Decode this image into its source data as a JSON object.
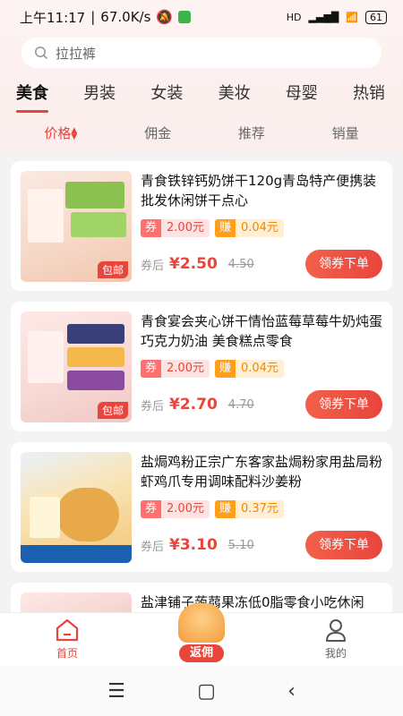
{
  "status_bar": {
    "time": "上午11:17",
    "speed": "67.0K/s",
    "network": "HD",
    "battery": "61"
  },
  "search": {
    "placeholder": "拉拉裤"
  },
  "categories": [
    "美食",
    "男装",
    "女装",
    "美妆",
    "母婴",
    "热销"
  ],
  "sort_options": [
    "价格",
    "佣金",
    "推荐",
    "销量"
  ],
  "products": [
    {
      "title": "青食铁锌钙奶饼干120g青岛特产便携装批发休闲饼干点心",
      "coupon_label": "券",
      "coupon_value": "2.00元",
      "earn_label": "赚",
      "earn_value": "0.04元",
      "after_label": "券后",
      "price": "¥2.50",
      "original_price": "4.50",
      "buy_label": "领券下单",
      "badge": "包邮"
    },
    {
      "title": "青食宴会夹心饼干情怡蓝莓草莓牛奶炖蛋巧克力奶油 美食糕点零食",
      "coupon_label": "券",
      "coupon_value": "2.00元",
      "earn_label": "赚",
      "earn_value": "0.04元",
      "after_label": "券后",
      "price": "¥2.70",
      "original_price": "4.70",
      "buy_label": "领券下单",
      "badge": "包邮"
    },
    {
      "title": "盐焗鸡粉正宗广东客家盐焗粉家用盐局粉虾鸡爪专用调味配料沙姜粉",
      "coupon_label": "券",
      "coupon_value": "2.00元",
      "earn_label": "赚",
      "earn_value": "0.37元",
      "after_label": "券后",
      "price": "¥3.10",
      "original_price": "5.10",
      "buy_label": "领券下单",
      "badge": ""
    },
    {
      "title": "盐津铺子蒟蒻果冻低0脂零食小吃休闲"
    }
  ],
  "tabbar": {
    "home": "首页",
    "rebate": "返佣",
    "mine": "我的"
  },
  "colors": {
    "accent": "#e8453c",
    "earn": "#ff9f1c"
  }
}
